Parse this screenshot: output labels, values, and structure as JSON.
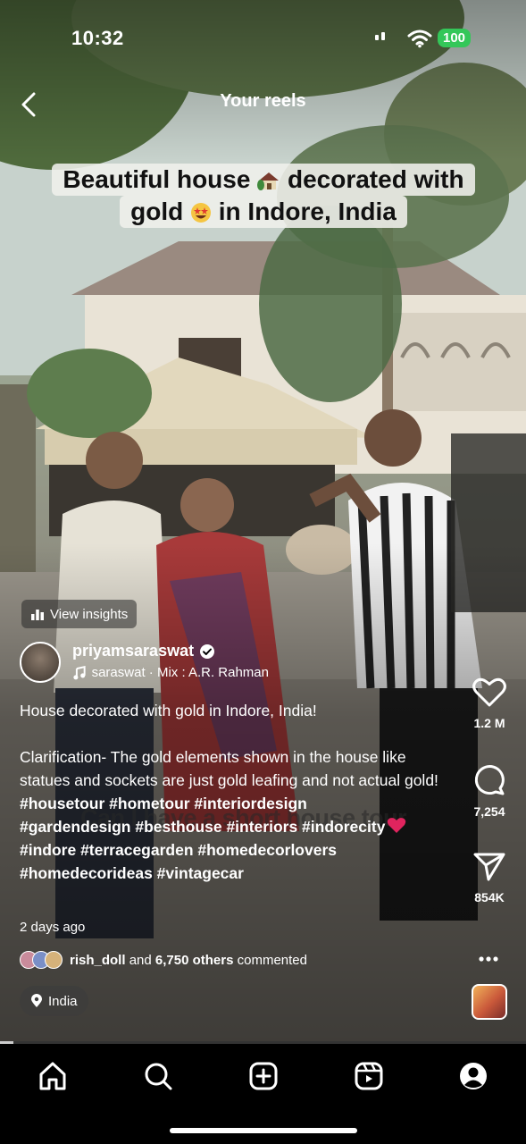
{
  "status": {
    "time": "10:32",
    "battery": "100"
  },
  "header": {
    "title": "Your reels"
  },
  "overlay": {
    "line1_a": "Beautiful house",
    "line1_b": "decorated with",
    "line2_a": "gold",
    "line2_b": "in Indore, India"
  },
  "insights": {
    "label": "View insights"
  },
  "author": {
    "username": "priyamsaraswat",
    "audio": "saraswat · Mix : A.R. Rahman"
  },
  "caption": {
    "line1": "House decorated with gold in Indore, India!",
    "clarification": "Clarification- The gold elements shown in the house like statues and sockets are just gold leafing and not actual gold!",
    "hashtags1": "#housetour #hometour #interiordesign",
    "hashtags2": "#gardendesign #besthouse #interiors #indorecity",
    "hashtags3": "#indore #terracegarden #homedecorlovers",
    "hashtags4": "#homedecorideas #vintagecar"
  },
  "time_ago": "2 days ago",
  "comments_summary": {
    "user": "rish_doll",
    "middle": "and",
    "others": "6,750 others",
    "suffix": "commented"
  },
  "location": {
    "label": "India"
  },
  "actions": {
    "likes": "1.2 M",
    "comments": "7,254",
    "shares": "854K"
  },
  "video_subtitle": "Can I have a short house tour",
  "progress": {
    "fraction": 0.026
  },
  "colors": {
    "battery": "#34c759",
    "heart_emoji": "#e0245e"
  }
}
